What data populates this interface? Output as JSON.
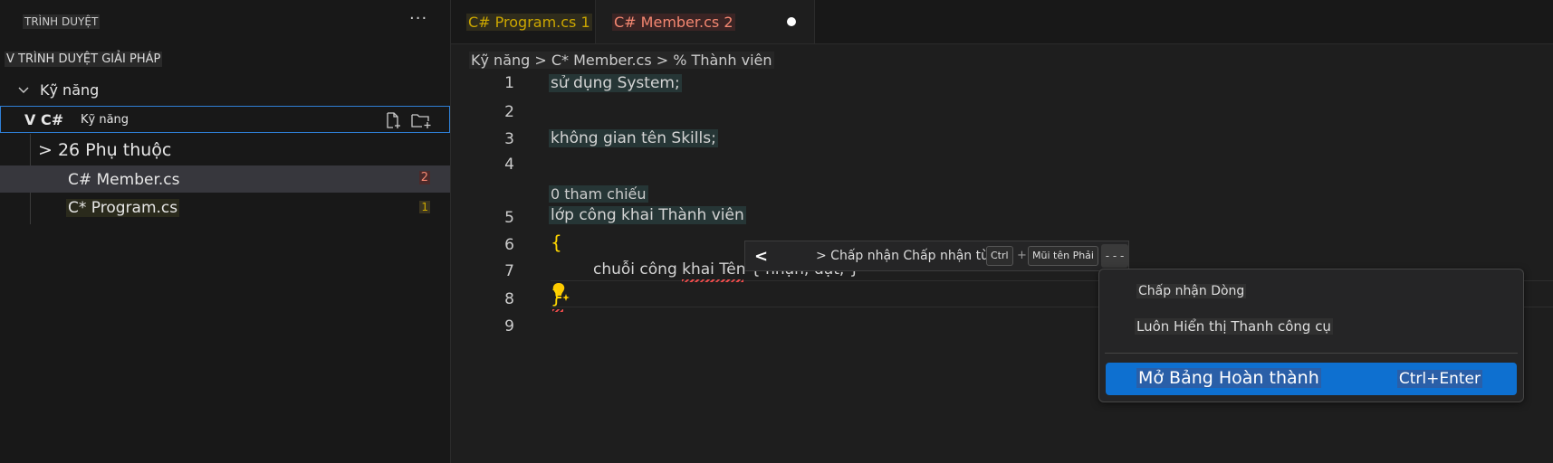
{
  "sidebar": {
    "title": "TRÌNH DUYỆT",
    "more": "···",
    "section": "V TRÌNH DUYỆT GIẢI PHÁP",
    "project": "Kỹ năng",
    "csharp_prefix": "V C#",
    "csharp_label": "Kỹ năng",
    "deps": "> 26 Phụ thuộc",
    "files": [
      {
        "label": "C# Member.cs",
        "badge": "2"
      },
      {
        "label": "C* Program.cs",
        "badge": "1"
      }
    ]
  },
  "tabs": [
    {
      "label": "C# Program.cs 1"
    },
    {
      "label": "C# Member.cs 2"
    }
  ],
  "breadcrumb": "Kỹ năng > C* Member.cs > % Thành viên",
  "editor": {
    "line_numbers": [
      "1",
      "2",
      "3",
      "4",
      "5",
      "6",
      "7",
      "8",
      "9"
    ],
    "line1": "sử dụng System;",
    "line3": "không gian tên Skills;",
    "codelens": "0 tham chiếu",
    "line5": "lớp công khai Thành viên",
    "line6": "{",
    "line7": "chuỗi công khai Tên { nhận; đặt; }",
    "line8": "}"
  },
  "inline_toolbar": {
    "prev": "<",
    "text": "> Chấp nhận Chấp nhận từ",
    "key1": "Ctrl",
    "plus": "+",
    "key2": "Mũi tên Phải",
    "more": "- - -"
  },
  "menu": {
    "item1": "Chấp nhận Dòng",
    "item2": "Luôn Hiển thị Thanh công cụ",
    "item3": "Mở Bảng Hoàn thành",
    "item3_key": "Ctrl+Enter"
  },
  "colors": {
    "accent": "#0e70d0",
    "error": "#f48771",
    "warning": "#cca700"
  }
}
